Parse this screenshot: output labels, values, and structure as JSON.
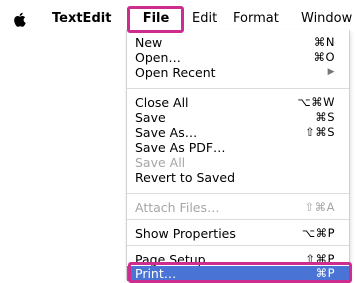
{
  "menubar": {
    "apple_icon": "apple-logo-icon",
    "app_name": "TextEdit",
    "items": [
      {
        "label": "File"
      },
      {
        "label": "Edit"
      },
      {
        "label": "Format"
      },
      {
        "label": "Window"
      }
    ]
  },
  "file_menu": {
    "items": [
      {
        "label": "New",
        "shortcut": "⌘N"
      },
      {
        "label": "Open…",
        "shortcut": "⌘O"
      },
      {
        "label": "Open Recent",
        "shortcut": "▶"
      },
      {
        "label": "Close All",
        "shortcut": "⌥⌘W"
      },
      {
        "label": "Save",
        "shortcut": "⌘S"
      },
      {
        "label": "Save As…",
        "shortcut": "⇧⌘S"
      },
      {
        "label": "Save As PDF…",
        "shortcut": ""
      },
      {
        "label": "Save All",
        "shortcut": ""
      },
      {
        "label": "Revert to Saved",
        "shortcut": ""
      },
      {
        "label": "Attach Files…",
        "shortcut": "⇧⌘A"
      },
      {
        "label": "Show Properties",
        "shortcut": "⌥⌘P"
      },
      {
        "label": "Page Setup…",
        "shortcut": "⇧⌘P"
      },
      {
        "label": "Print…",
        "shortcut": "⌘P"
      }
    ]
  },
  "colors": {
    "highlight": "#4a73d6",
    "callout": "#cc2d8e",
    "disabled_text": "#a6a6a6"
  }
}
